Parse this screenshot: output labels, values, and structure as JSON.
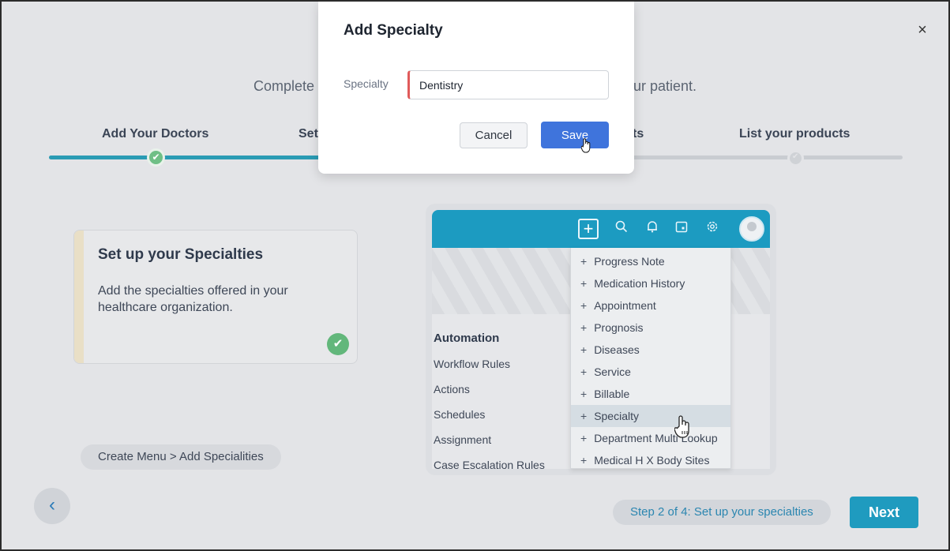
{
  "wizard": {
    "subtitle_start": "Complete",
    "subtitle_end": "ur patient.",
    "steps": [
      {
        "label": "Add Your Doctors"
      },
      {
        "label": "Set"
      },
      {
        "label": "ts"
      },
      {
        "label": "List your products"
      }
    ],
    "close_label": "×"
  },
  "info_card": {
    "title": "Set up your Specialties",
    "description": "Add the specialties offered in your healthcare organization.",
    "check": "✔"
  },
  "path_chip": "Create Menu > Add Specialities",
  "preview": {
    "automation_title": "Automation",
    "automation_items": [
      "Workflow Rules",
      "Actions",
      "Schedules",
      "Assignment",
      "Case Escalation Rules"
    ],
    "dropdown_items": [
      "Progress Note",
      "Medication History",
      "Appointment",
      "Prognosis",
      "Diseases",
      "Service",
      "Billable",
      "Specialty",
      "Department Multi Lookup",
      "Medical H X Body Sites"
    ],
    "highlighted_item": "Specialty"
  },
  "footer": {
    "back_label": "‹",
    "step_info": "Step 2 of 4: Set up your specialties",
    "next_label": "Next"
  },
  "modal": {
    "title": "Add Specialty",
    "field_label": "Specialty",
    "field_value": "Dentistry",
    "cancel_label": "Cancel",
    "save_label": "Save"
  },
  "colors": {
    "accent": "#1f9bbf",
    "save_button": "#3f74dc",
    "progress": "#2a9bb4",
    "done": "#62b77b"
  }
}
